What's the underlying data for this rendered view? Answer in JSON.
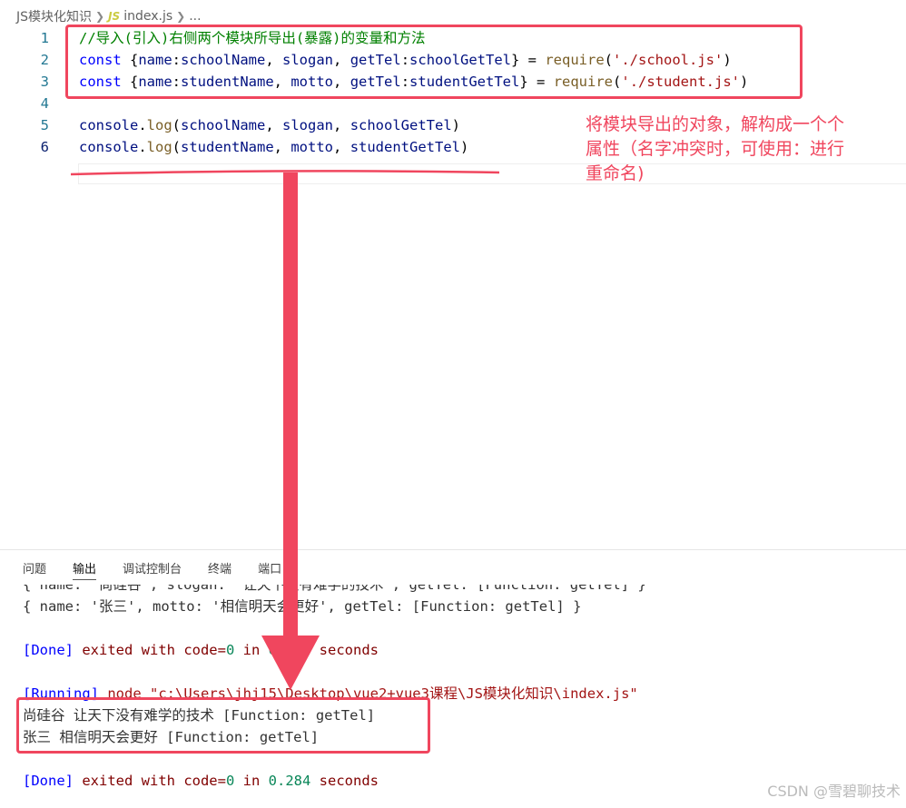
{
  "breadcrumb": {
    "folder": "JS模块化知识",
    "file_icon": "JS",
    "file": "index.js",
    "more": "..."
  },
  "editor": {
    "lines": [
      {
        "num": "1",
        "tokens": [
          {
            "t": "//导入(引入)右侧两个模块所导出(暴露)的变量和方法",
            "c": "c-comment"
          }
        ]
      },
      {
        "num": "2",
        "tokens": [
          {
            "t": "const",
            "c": "c-kw"
          },
          {
            "t": " {",
            "c": "c-plain"
          },
          {
            "t": "name",
            "c": "c-var"
          },
          {
            "t": ":",
            "c": "c-plain"
          },
          {
            "t": "schoolName",
            "c": "c-var"
          },
          {
            "t": ", ",
            "c": "c-plain"
          },
          {
            "t": "slogan",
            "c": "c-var"
          },
          {
            "t": ", ",
            "c": "c-plain"
          },
          {
            "t": "getTel",
            "c": "c-var"
          },
          {
            "t": ":",
            "c": "c-plain"
          },
          {
            "t": "schoolGetTel",
            "c": "c-var"
          },
          {
            "t": "} = ",
            "c": "c-plain"
          },
          {
            "t": "require",
            "c": "c-fn"
          },
          {
            "t": "(",
            "c": "c-plain"
          },
          {
            "t": "'./school.js'",
            "c": "c-str"
          },
          {
            "t": ")",
            "c": "c-plain"
          }
        ]
      },
      {
        "num": "3",
        "tokens": [
          {
            "t": "const",
            "c": "c-kw"
          },
          {
            "t": " {",
            "c": "c-plain"
          },
          {
            "t": "name",
            "c": "c-var"
          },
          {
            "t": ":",
            "c": "c-plain"
          },
          {
            "t": "studentName",
            "c": "c-var"
          },
          {
            "t": ", ",
            "c": "c-plain"
          },
          {
            "t": "motto",
            "c": "c-var"
          },
          {
            "t": ", ",
            "c": "c-plain"
          },
          {
            "t": "getTel",
            "c": "c-var"
          },
          {
            "t": ":",
            "c": "c-plain"
          },
          {
            "t": "studentGetTel",
            "c": "c-var"
          },
          {
            "t": "} = ",
            "c": "c-plain"
          },
          {
            "t": "require",
            "c": "c-fn"
          },
          {
            "t": "(",
            "c": "c-plain"
          },
          {
            "t": "'./student.js'",
            "c": "c-str"
          },
          {
            "t": ")",
            "c": "c-plain"
          }
        ]
      },
      {
        "num": "4",
        "tokens": []
      },
      {
        "num": "5",
        "tokens": [
          {
            "t": "console",
            "c": "c-var"
          },
          {
            "t": ".",
            "c": "c-plain"
          },
          {
            "t": "log",
            "c": "c-fn"
          },
          {
            "t": "(",
            "c": "c-plain"
          },
          {
            "t": "schoolName",
            "c": "c-var"
          },
          {
            "t": ", ",
            "c": "c-plain"
          },
          {
            "t": "slogan",
            "c": "c-var"
          },
          {
            "t": ", ",
            "c": "c-plain"
          },
          {
            "t": "schoolGetTel",
            "c": "c-var"
          },
          {
            "t": ")",
            "c": "c-plain"
          }
        ]
      },
      {
        "num": "6",
        "active": true,
        "tokens": [
          {
            "t": "console",
            "c": "c-var"
          },
          {
            "t": ".",
            "c": "c-plain"
          },
          {
            "t": "log",
            "c": "c-fn"
          },
          {
            "t": "(",
            "c": "c-plain"
          },
          {
            "t": "studentName",
            "c": "c-var"
          },
          {
            "t": ", ",
            "c": "c-plain"
          },
          {
            "t": "motto",
            "c": "c-var"
          },
          {
            "t": ", ",
            "c": "c-plain"
          },
          {
            "t": "studentGetTel",
            "c": "c-var"
          },
          {
            "t": ")",
            "c": "c-plain"
          }
        ]
      }
    ]
  },
  "annotation": {
    "line1": "将模块导出的对象，解构成一个个",
    "line2": "属性（名字冲突时，可使用：进行",
    "line3": "重命名)",
    "color": "#f0465e"
  },
  "panel": {
    "tabs": [
      {
        "label": "问题",
        "active": false
      },
      {
        "label": "输出",
        "active": true
      },
      {
        "label": "调试控制台",
        "active": false
      },
      {
        "label": "终端",
        "active": false
      },
      {
        "label": "端口",
        "active": false
      }
    ],
    "output": [
      {
        "tokens": [
          {
            "t": "{ name: '尚硅谷', slogan: '让天下没有难学的技术', getTel: [Function: getTel] }",
            "c": ""
          }
        ]
      },
      {
        "tokens": [
          {
            "t": "{ name: '张三', motto: '相信明天会更好', getTel: [Function: getTel] }",
            "c": ""
          }
        ]
      },
      {
        "tokens": []
      },
      {
        "tokens": [
          {
            "t": "[Done]",
            "c": "o-done"
          },
          {
            "t": " exited with code=",
            "c": "o-exit"
          },
          {
            "t": "0",
            "c": "o-num"
          },
          {
            "t": " in ",
            "c": "o-exit"
          },
          {
            "t": "0.295",
            "c": "o-num"
          },
          {
            "t": " seconds",
            "c": "o-exit"
          }
        ]
      },
      {
        "tokens": []
      },
      {
        "tokens": [
          {
            "t": "[Running]",
            "c": "o-run"
          },
          {
            "t": " node \"c:\\Users\\jhj15\\Desktop\\vue2+vue3课程\\JS模块化知识\\index.js\"",
            "c": "o-cmd"
          }
        ]
      },
      {
        "tokens": [
          {
            "t": "尚硅谷 让天下没有难学的技术 [Function: getTel]",
            "c": ""
          }
        ]
      },
      {
        "tokens": [
          {
            "t": "张三 相信明天会更好 [Function: getTel]",
            "c": ""
          }
        ]
      },
      {
        "tokens": []
      },
      {
        "tokens": [
          {
            "t": "[Done]",
            "c": "o-done"
          },
          {
            "t": " exited with code=",
            "c": "o-exit"
          },
          {
            "t": "0",
            "c": "o-num"
          },
          {
            "t": " in ",
            "c": "o-exit"
          },
          {
            "t": "0.284",
            "c": "o-num"
          },
          {
            "t": " seconds",
            "c": "o-exit"
          }
        ]
      }
    ]
  },
  "watermark": "CSDN @雪碧聊技术"
}
